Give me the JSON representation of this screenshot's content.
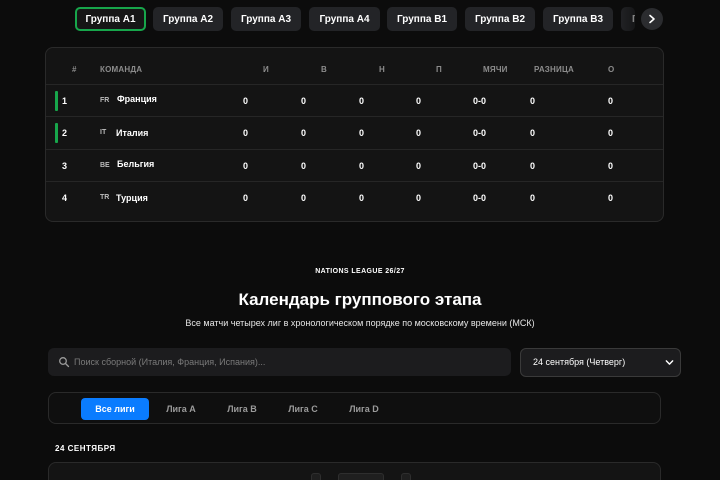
{
  "group_tabs": {
    "tabs": [
      {
        "label": "Группа A1",
        "active": true
      },
      {
        "label": "Группа A2",
        "active": false
      },
      {
        "label": "Группа A3",
        "active": false
      },
      {
        "label": "Группа A4",
        "active": false
      },
      {
        "label": "Группа B1",
        "active": false
      },
      {
        "label": "Группа B2",
        "active": false
      },
      {
        "label": "Группа B3",
        "active": false
      },
      {
        "label": "Г",
        "active": false
      }
    ],
    "next_icon": "chevron-right-icon"
  },
  "standings": {
    "headers": [
      "#",
      "КОМАНДА",
      "И",
      "В",
      "Н",
      "П",
      "МЯЧИ",
      "РАЗНИЦА",
      "О"
    ],
    "rows": [
      {
        "pos": "1",
        "code": "FR",
        "team": "Франция",
        "played": "0",
        "won": "0",
        "drawn": "0",
        "lost": "0",
        "goals": "0-0",
        "diff": "0",
        "points": "0",
        "qualified": true
      },
      {
        "pos": "2",
        "code": "IT",
        "team": "Италия",
        "played": "0",
        "won": "0",
        "drawn": "0",
        "lost": "0",
        "goals": "0-0",
        "diff": "0",
        "points": "0",
        "qualified": true
      },
      {
        "pos": "3",
        "code": "BE",
        "team": "Бельгия",
        "played": "0",
        "won": "0",
        "drawn": "0",
        "lost": "0",
        "goals": "0-0",
        "diff": "0",
        "points": "0",
        "qualified": false
      },
      {
        "pos": "4",
        "code": "TR",
        "team": "Турция",
        "played": "0",
        "won": "0",
        "drawn": "0",
        "lost": "0",
        "goals": "0-0",
        "diff": "0",
        "points": "0",
        "qualified": false
      }
    ]
  },
  "calendar": {
    "league_label": "NATIONS LEAGUE 26/27",
    "title": "Календарь группового этапа",
    "subtitle": "Все матчи четырех лиг в хронологическом порядке по московскому времени (МСК)",
    "search": {
      "placeholder": "Поиск сборной (Италия, Франция, Испания)...",
      "value": ""
    },
    "date_select": {
      "value": "24 сентября (Четверг)"
    },
    "league_tabs": [
      {
        "label": "Все лиги",
        "active": true
      },
      {
        "label": "Лига A",
        "active": false
      },
      {
        "label": "Лига B",
        "active": false
      },
      {
        "label": "Лига C",
        "active": false
      },
      {
        "label": "Лига D",
        "active": false
      }
    ],
    "date_heading": "24 СЕНТЯБРЯ"
  },
  "colors": {
    "background": "#0c0c0c",
    "accent_green": "#17a64b",
    "accent_blue": "#0a7cff",
    "panel": "#141414"
  }
}
